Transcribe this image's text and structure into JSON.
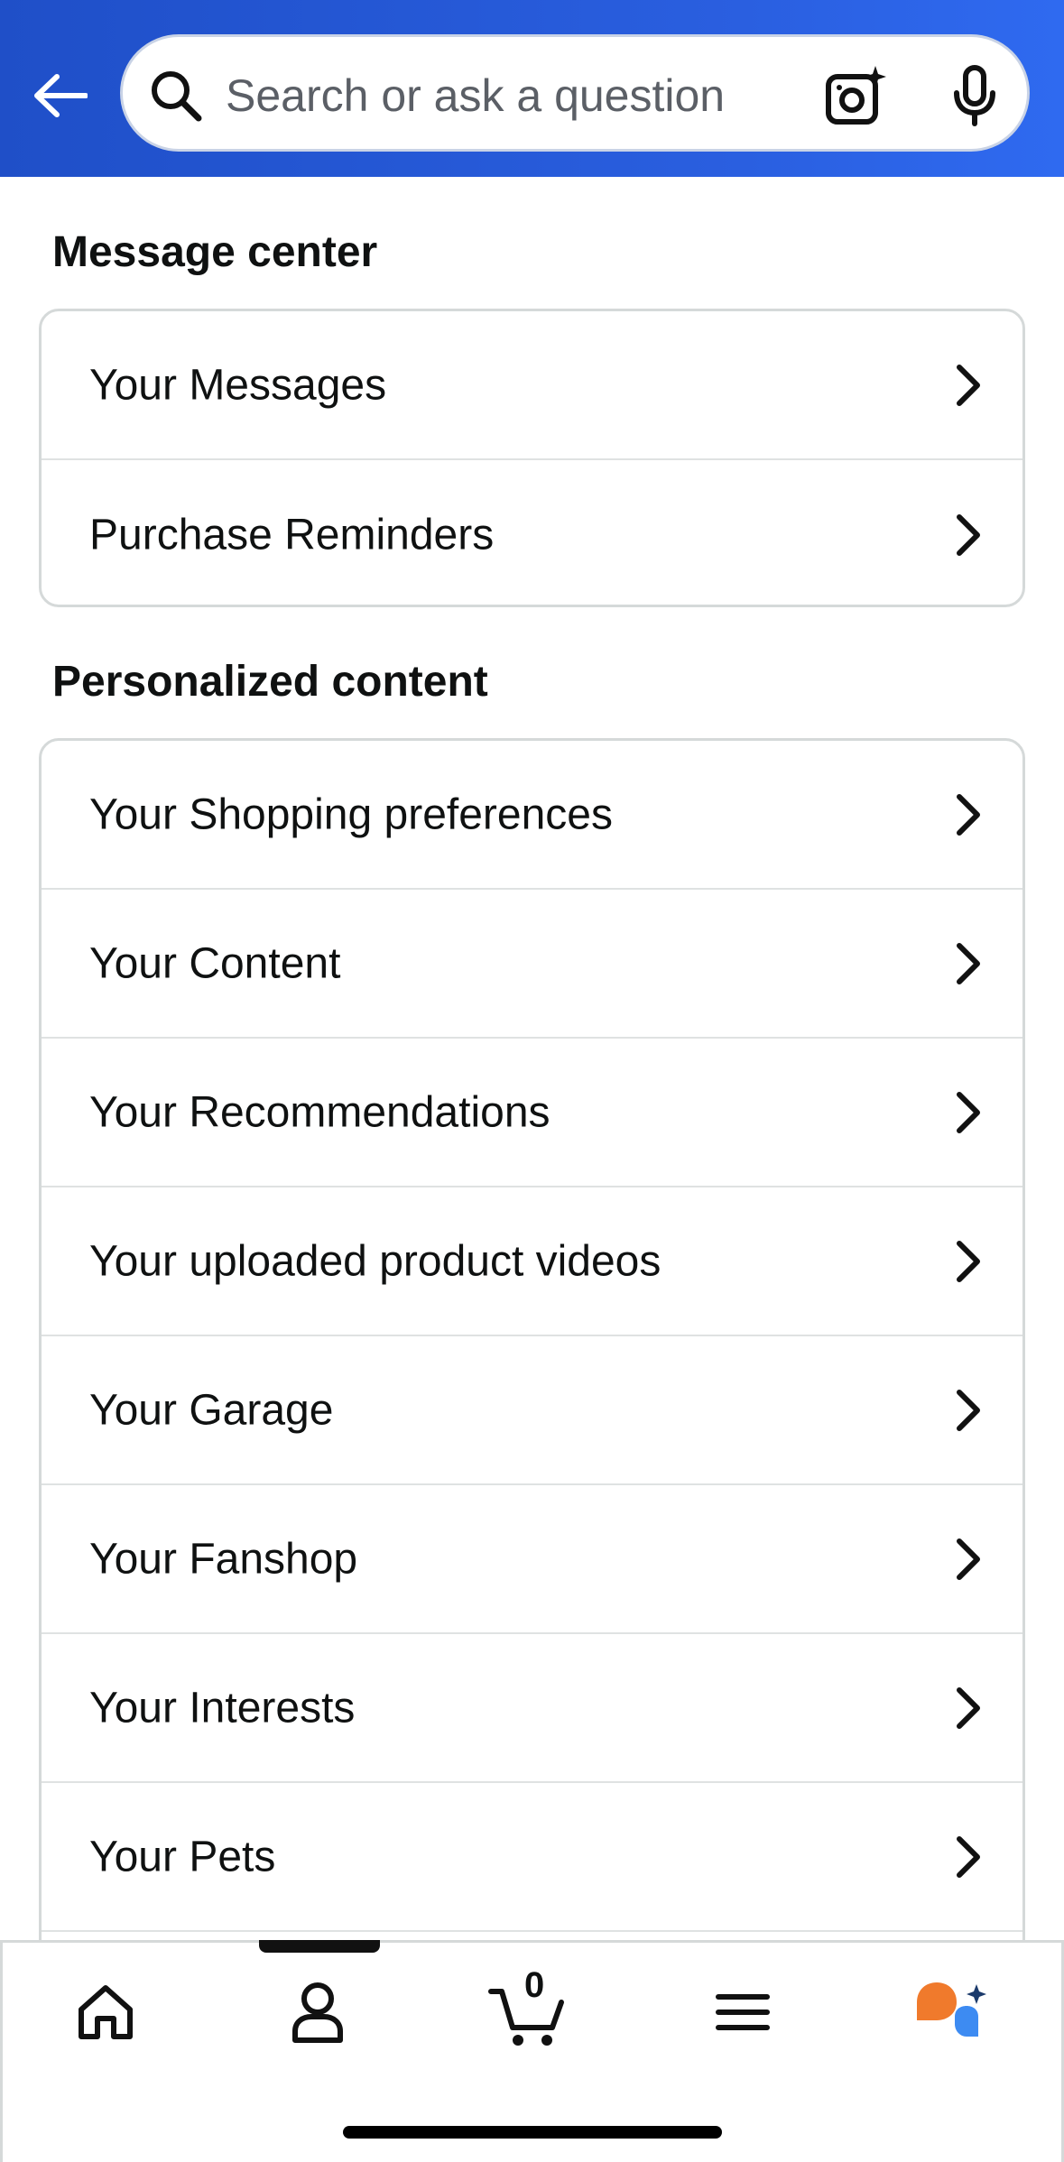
{
  "search": {
    "placeholder": "Search or ask a question"
  },
  "sections": {
    "message_center": {
      "title": "Message center",
      "items": [
        "Your Messages",
        "Purchase Reminders"
      ]
    },
    "personalized_content": {
      "title": "Personalized content",
      "items": [
        "Your Shopping preferences",
        "Your Content",
        "Your Recommendations",
        "Your uploaded product videos",
        "Your Garage",
        "Your Fanshop",
        "Your Interests",
        "Your Pets"
      ]
    }
  },
  "bottom_nav": {
    "cart_count": "0",
    "items": [
      "home-icon",
      "account-icon",
      "cart-icon",
      "menu-icon",
      "rufus-assistant-icon"
    ],
    "active": "account-icon"
  },
  "colors": {
    "header_start": "#1f4fc8",
    "header_end": "#2f6af0",
    "assistant_orange": "#f07a2c",
    "assistant_blue": "#3d8bf2",
    "sparkle_navy": "#1b3a6b"
  }
}
